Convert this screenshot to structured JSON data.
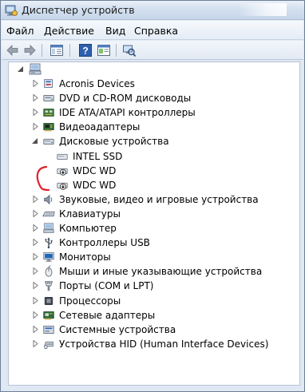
{
  "window": {
    "title": "Диспетчер устройств"
  },
  "menu": [
    "Файл",
    "Действие",
    "Вид",
    "Справка"
  ],
  "toolbar": [
    "back-icon",
    "forward-icon",
    "show-hide-tree-icon",
    "help-icon",
    "properties-icon",
    "scan-hardware-icon"
  ],
  "tree": {
    "root_icon": "computer-icon",
    "items": [
      {
        "label": "Acronis Devices",
        "icon": "acronis-icon",
        "expanded": false
      },
      {
        "label": "DVD и CD-ROM дисководы",
        "icon": "dvd-icon",
        "expanded": false
      },
      {
        "label": "IDE ATA/ATAPI контроллеры",
        "icon": "ide-controller-icon",
        "expanded": false
      },
      {
        "label": "Видеоадаптеры",
        "icon": "display-adapter-icon",
        "expanded": false
      },
      {
        "label": "Дисковые устройства",
        "icon": "disk-drive-icon",
        "expanded": true,
        "children": [
          {
            "label": "INTEL SSD",
            "icon": "disk-icon"
          },
          {
            "label": "WDC WD",
            "icon": "disk-down-icon"
          },
          {
            "label": "WDC WD",
            "icon": "disk-down-icon"
          }
        ]
      },
      {
        "label": "Звуковые, видео и игровые устройства",
        "icon": "sound-icon",
        "expanded": false
      },
      {
        "label": "Клавиатуры",
        "icon": "keyboard-icon",
        "expanded": false
      },
      {
        "label": "Компьютер",
        "icon": "computer-icon",
        "expanded": false
      },
      {
        "label": "Контроллеры USB",
        "icon": "usb-icon",
        "expanded": false
      },
      {
        "label": "Мониторы",
        "icon": "monitor-icon",
        "expanded": false
      },
      {
        "label": "Мыши и иные указывающие устройства",
        "icon": "mouse-icon",
        "expanded": false
      },
      {
        "label": "Порты (COM и LPT)",
        "icon": "port-icon",
        "expanded": false
      },
      {
        "label": "Процессоры",
        "icon": "processor-icon",
        "expanded": false
      },
      {
        "label": "Сетевые адаптеры",
        "icon": "network-icon",
        "expanded": false
      },
      {
        "label": "Системные устройства",
        "icon": "system-device-icon",
        "expanded": false
      },
      {
        "label": "Устройства HID (Human Interface Devices)",
        "icon": "hid-icon",
        "expanded": false
      }
    ]
  },
  "colors": {
    "annotation": "#e0202b",
    "tree_triangle": "#7a7a7a"
  }
}
